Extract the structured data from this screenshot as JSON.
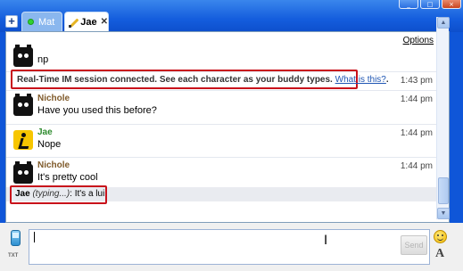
{
  "tabs": [
    {
      "label": "Mat"
    },
    {
      "label": "Jae"
    }
  ],
  "window_controls": {
    "minimize": "_",
    "maximize": "□",
    "close": "×"
  },
  "new_tab_label": "+",
  "tab_close_glyph": "✕",
  "chat": {
    "options_label": "Options",
    "messages": [
      {
        "text": "np"
      },
      {
        "system": "Real-Time IM session connected. See each character as your buddy types.",
        "link": "What is this?",
        "link_suffix": ".",
        "time": "1:43 pm"
      },
      {
        "name": "Nichole",
        "text": "Have you used this before?",
        "time": "1:44 pm"
      },
      {
        "name": "Jae",
        "text": "Nope",
        "time": "1:44 pm"
      },
      {
        "name": "Nichole",
        "text": "It's pretty cool",
        "time": "1:44 pm"
      }
    ],
    "typing": {
      "name": "Jae",
      "status": "(typing...)",
      "separator": ":",
      "text": "It's a lui"
    }
  },
  "input": {
    "send_label": "Send",
    "txt_label": "TXT"
  },
  "colors": {
    "title_blue": "#0f56d8",
    "highlight_red": "#c8111b",
    "nichole_name": "#7f5a2a",
    "jae_name": "#2e8b2e",
    "link": "#1f56b3"
  },
  "icons": [
    "new-tab-icon",
    "online-status-icon",
    "typing-pencil-icon",
    "close-icon",
    "buddy-avatar-icon",
    "aim-runner-icon",
    "mobile-text-icon",
    "smiley-icon",
    "font-icon",
    "text-cursor-icon",
    "scroll-up-icon",
    "scroll-down-icon"
  ]
}
